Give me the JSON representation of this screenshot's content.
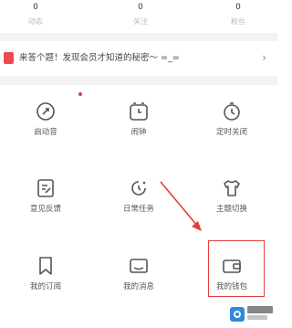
{
  "stats": [
    {
      "count": "0",
      "label": "动态"
    },
    {
      "count": "0",
      "label": "关注"
    },
    {
      "count": "0",
      "label": "粉丝"
    }
  ],
  "banner": {
    "text": "来答个题！发现会员才知道的秘密～ =_=",
    "more": "›",
    "icon": "calendar-icon"
  },
  "grid": [
    {
      "label": "启动音",
      "icon": "sound-icon"
    },
    {
      "label": "闹钟",
      "icon": "alarm-clock-icon"
    },
    {
      "label": "定时关闭",
      "icon": "timer-icon"
    },
    {
      "label": "意见反馈",
      "icon": "feedback-icon"
    },
    {
      "label": "日常任务",
      "icon": "task-icon"
    },
    {
      "label": "主题切换",
      "icon": "shirt-icon"
    },
    {
      "label": "我的订阅",
      "icon": "bookmark-icon"
    },
    {
      "label": "我的消息",
      "icon": "message-icon"
    },
    {
      "label": "我的钱包",
      "icon": "wallet-icon"
    }
  ],
  "colors": {
    "highlight": "#e53b3b",
    "banner_icon": "#ee4b4b",
    "icon_stroke": "#555555"
  }
}
